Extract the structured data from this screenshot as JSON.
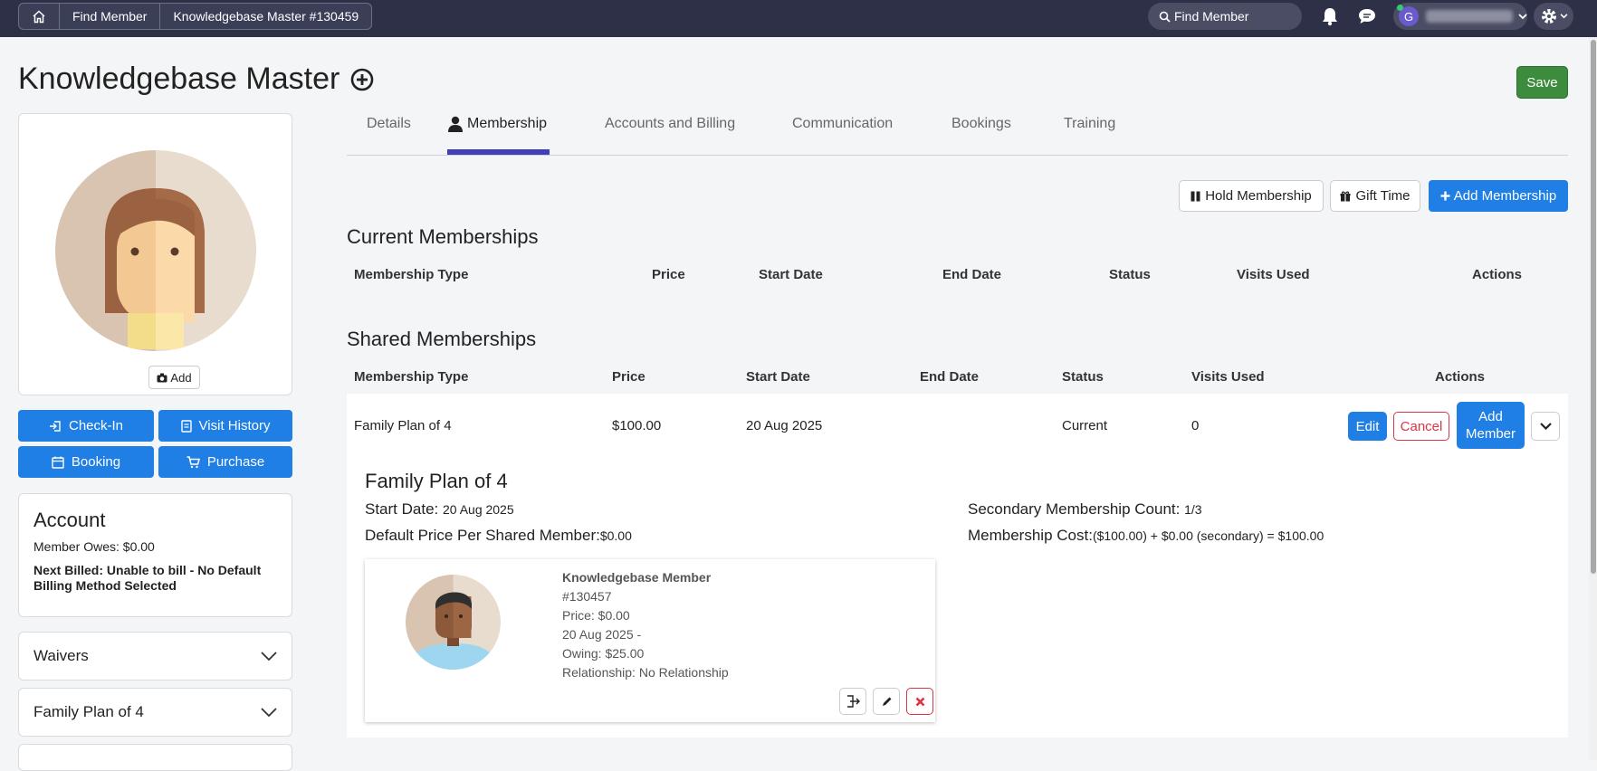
{
  "breadcrumb": {
    "items": [
      "Find Member",
      "Knowledgebase Master #130459"
    ]
  },
  "topbar": {
    "search_placeholder": "Find Member",
    "user_initial": "G"
  },
  "page": {
    "title": "Knowledgebase Master",
    "save_label": "Save"
  },
  "profile": {
    "add_photo_label": "Add"
  },
  "quick_actions": {
    "check_in": "Check-In",
    "visit_history": "Visit History",
    "booking": "Booking",
    "purchase": "Purchase"
  },
  "account": {
    "title": "Account",
    "member_owes": "Member Owes: $0.00",
    "next_billed": "Next Billed: Unable to bill - No Default Billing Method Selected"
  },
  "panels": [
    "Waivers",
    "Family Plan of 4"
  ],
  "tabs": [
    {
      "label": "Details"
    },
    {
      "label": "Membership"
    },
    {
      "label": "Accounts and Billing"
    },
    {
      "label": "Communication"
    },
    {
      "label": "Bookings"
    },
    {
      "label": "Training"
    }
  ],
  "membership_actions": {
    "hold": "Hold Membership",
    "gift": "Gift Time",
    "add": "Add Membership"
  },
  "current_memberships": {
    "title": "Current Memberships",
    "headers": [
      "Membership Type",
      "Price",
      "Start Date",
      "End Date",
      "Status",
      "Visits Used",
      "Actions"
    ]
  },
  "shared_memberships": {
    "title": "Shared Memberships",
    "headers": [
      "Membership Type",
      "Price",
      "Start Date",
      "End Date",
      "Status",
      "Visits Used",
      "Actions"
    ],
    "row": {
      "type": "Family Plan of 4",
      "price": "$100.00",
      "start_date": "20 Aug 2025",
      "end_date": "",
      "status": "Current",
      "visits_used": "0",
      "edit_label": "Edit",
      "cancel_label": "Cancel",
      "add_member_label": "Add Member"
    }
  },
  "shared_detail": {
    "title": "Family Plan of 4",
    "start_date_label": "Start Date:",
    "start_date_value": "20 Aug 2025",
    "default_price_label": "Default Price Per Shared Member:",
    "default_price_value": "$0.00",
    "secondary_count_label": "Secondary Membership Count:",
    "secondary_count_value": "1/3",
    "cost_label": "Membership Cost:",
    "cost_value": "($100.00) + $0.00 (secondary) = $100.00"
  },
  "shared_member": {
    "name": "Knowledgebase Member",
    "id": "#130457",
    "price": "Price: $0.00",
    "dates": "20 Aug 2025 -",
    "owing": "Owing: $25.00",
    "relationship": "Relationship: No Relationship"
  }
}
